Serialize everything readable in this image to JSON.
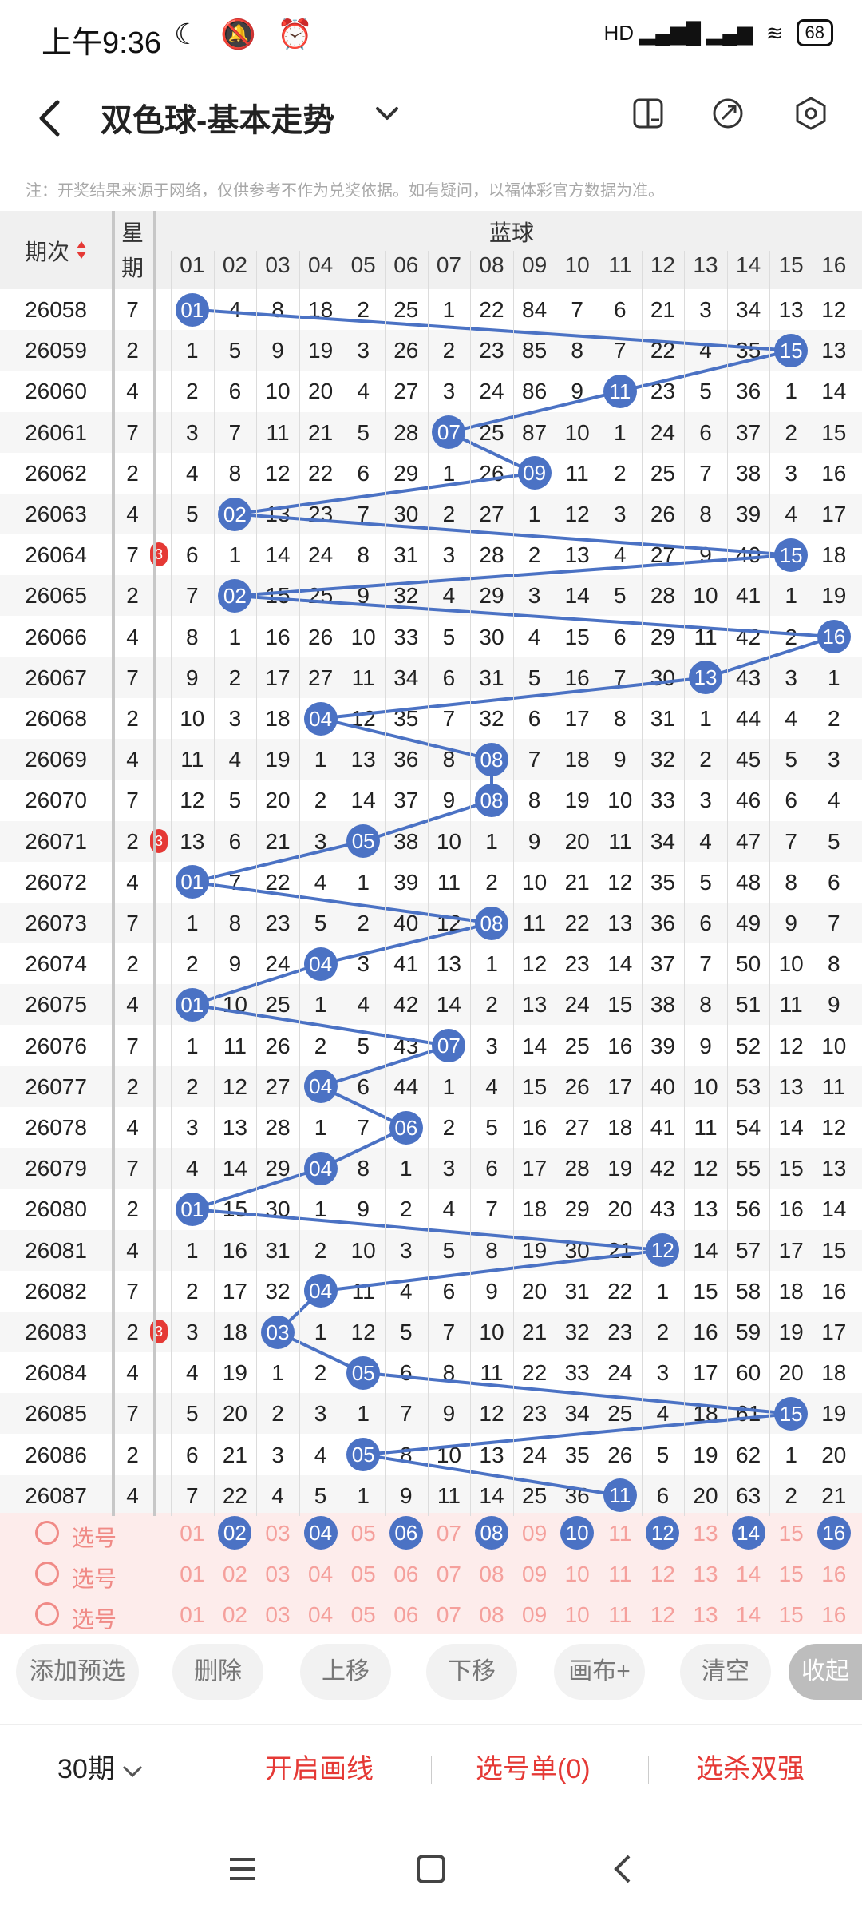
{
  "status": {
    "time": "上午9:36",
    "left_icons": "☾ 🔕 ⏰",
    "signal": "HD ▂▄▆█ ▂▄▆",
    "wifi": "≋",
    "battery": "68"
  },
  "header": {
    "title": "双色球-基本走势"
  },
  "note": "注：开奖结果来源于网络，仅供参考不作为兑奖依据。如有疑问，以福体彩官方数据为准。",
  "table": {
    "col_qici": "期次",
    "col_week_1": "星",
    "col_week_2": "期",
    "group_label": "蓝球",
    "col_numbers": [
      "01",
      "02",
      "03",
      "04",
      "05",
      "06",
      "07",
      "08",
      "09",
      "10",
      "11",
      "12",
      "13",
      "14",
      "15",
      "16"
    ],
    "rows": [
      {
        "q": "26058",
        "w": "7",
        "c": [
          "01",
          "4",
          "8",
          "18",
          "2",
          "25",
          "1",
          "22",
          "84",
          "7",
          "6",
          "21",
          "3",
          "34",
          "13",
          "12"
        ]
      },
      {
        "q": "26059",
        "w": "2",
        "c": [
          "1",
          "5",
          "9",
          "19",
          "3",
          "26",
          "2",
          "23",
          "85",
          "8",
          "7",
          "22",
          "4",
          "35",
          "15",
          "13"
        ]
      },
      {
        "q": "26060",
        "w": "4",
        "c": [
          "2",
          "6",
          "10",
          "20",
          "4",
          "27",
          "3",
          "24",
          "86",
          "9",
          "11",
          "23",
          "5",
          "36",
          "1",
          "14"
        ]
      },
      {
        "q": "26061",
        "w": "7",
        "c": [
          "3",
          "7",
          "11",
          "21",
          "5",
          "28",
          "07",
          "25",
          "87",
          "10",
          "1",
          "24",
          "6",
          "37",
          "2",
          "15"
        ]
      },
      {
        "q": "26062",
        "w": "2",
        "c": [
          "4",
          "8",
          "12",
          "22",
          "6",
          "29",
          "1",
          "26",
          "09",
          "11",
          "2",
          "25",
          "7",
          "38",
          "3",
          "16"
        ]
      },
      {
        "q": "26063",
        "w": "4",
        "c": [
          "5",
          "02",
          "13",
          "23",
          "7",
          "30",
          "2",
          "27",
          "1",
          "12",
          "3",
          "26",
          "8",
          "39",
          "4",
          "17"
        ]
      },
      {
        "q": "26064",
        "w": "7",
        "c": [
          "6",
          "1",
          "14",
          "24",
          "8",
          "31",
          "3",
          "28",
          "2",
          "13",
          "4",
          "27",
          "9",
          "40",
          "15",
          "18"
        ],
        "red": "3"
      },
      {
        "q": "26065",
        "w": "2",
        "c": [
          "7",
          "02",
          "15",
          "25",
          "9",
          "32",
          "4",
          "29",
          "3",
          "14",
          "5",
          "28",
          "10",
          "41",
          "1",
          "19"
        ]
      },
      {
        "q": "26066",
        "w": "4",
        "c": [
          "8",
          "1",
          "16",
          "26",
          "10",
          "33",
          "5",
          "30",
          "4",
          "15",
          "6",
          "29",
          "11",
          "42",
          "2",
          "16"
        ]
      },
      {
        "q": "26067",
        "w": "7",
        "c": [
          "9",
          "2",
          "17",
          "27",
          "11",
          "34",
          "6",
          "31",
          "5",
          "16",
          "7",
          "30",
          "13",
          "43",
          "3",
          "1"
        ]
      },
      {
        "q": "26068",
        "w": "2",
        "c": [
          "10",
          "3",
          "18",
          "04",
          "12",
          "35",
          "7",
          "32",
          "6",
          "17",
          "8",
          "31",
          "1",
          "44",
          "4",
          "2"
        ]
      },
      {
        "q": "26069",
        "w": "4",
        "c": [
          "11",
          "4",
          "19",
          "1",
          "13",
          "36",
          "8",
          "08",
          "7",
          "18",
          "9",
          "32",
          "2",
          "45",
          "5",
          "3"
        ]
      },
      {
        "q": "26070",
        "w": "7",
        "c": [
          "12",
          "5",
          "20",
          "2",
          "14",
          "37",
          "9",
          "08",
          "8",
          "19",
          "10",
          "33",
          "3",
          "46",
          "6",
          "4"
        ]
      },
      {
        "q": "26071",
        "w": "2",
        "c": [
          "13",
          "6",
          "21",
          "3",
          "05",
          "38",
          "10",
          "1",
          "9",
          "20",
          "11",
          "34",
          "4",
          "47",
          "7",
          "5"
        ],
        "red": "3"
      },
      {
        "q": "26072",
        "w": "4",
        "c": [
          "01",
          "7",
          "22",
          "4",
          "1",
          "39",
          "11",
          "2",
          "10",
          "21",
          "12",
          "35",
          "5",
          "48",
          "8",
          "6"
        ]
      },
      {
        "q": "26073",
        "w": "7",
        "c": [
          "1",
          "8",
          "23",
          "5",
          "2",
          "40",
          "12",
          "08",
          "11",
          "22",
          "13",
          "36",
          "6",
          "49",
          "9",
          "7"
        ]
      },
      {
        "q": "26074",
        "w": "2",
        "c": [
          "2",
          "9",
          "24",
          "04",
          "3",
          "41",
          "13",
          "1",
          "12",
          "23",
          "14",
          "37",
          "7",
          "50",
          "10",
          "8"
        ]
      },
      {
        "q": "26075",
        "w": "4",
        "c": [
          "01",
          "10",
          "25",
          "1",
          "4",
          "42",
          "14",
          "2",
          "13",
          "24",
          "15",
          "38",
          "8",
          "51",
          "11",
          "9"
        ]
      },
      {
        "q": "26076",
        "w": "7",
        "c": [
          "1",
          "11",
          "26",
          "2",
          "5",
          "43",
          "07",
          "3",
          "14",
          "25",
          "16",
          "39",
          "9",
          "52",
          "12",
          "10"
        ]
      },
      {
        "q": "26077",
        "w": "2",
        "c": [
          "2",
          "12",
          "27",
          "04",
          "6",
          "44",
          "1",
          "4",
          "15",
          "26",
          "17",
          "40",
          "10",
          "53",
          "13",
          "11"
        ]
      },
      {
        "q": "26078",
        "w": "4",
        "c": [
          "3",
          "13",
          "28",
          "1",
          "7",
          "06",
          "2",
          "5",
          "16",
          "27",
          "18",
          "41",
          "11",
          "54",
          "14",
          "12"
        ]
      },
      {
        "q": "26079",
        "w": "7",
        "c": [
          "4",
          "14",
          "29",
          "04",
          "8",
          "1",
          "3",
          "6",
          "17",
          "28",
          "19",
          "42",
          "12",
          "55",
          "15",
          "13"
        ]
      },
      {
        "q": "26080",
        "w": "2",
        "c": [
          "01",
          "15",
          "30",
          "1",
          "9",
          "2",
          "4",
          "7",
          "18",
          "29",
          "20",
          "43",
          "13",
          "56",
          "16",
          "14"
        ]
      },
      {
        "q": "26081",
        "w": "4",
        "c": [
          "1",
          "16",
          "31",
          "2",
          "10",
          "3",
          "5",
          "8",
          "19",
          "30",
          "21",
          "12",
          "14",
          "57",
          "17",
          "15"
        ]
      },
      {
        "q": "26082",
        "w": "7",
        "c": [
          "2",
          "17",
          "32",
          "04",
          "11",
          "4",
          "6",
          "9",
          "20",
          "31",
          "22",
          "1",
          "15",
          "58",
          "18",
          "16"
        ]
      },
      {
        "q": "26083",
        "w": "2",
        "c": [
          "3",
          "18",
          "03",
          "1",
          "12",
          "5",
          "7",
          "10",
          "21",
          "32",
          "23",
          "2",
          "16",
          "59",
          "19",
          "17"
        ],
        "red": "3"
      },
      {
        "q": "26084",
        "w": "4",
        "c": [
          "4",
          "19",
          "1",
          "2",
          "05",
          "6",
          "8",
          "11",
          "22",
          "33",
          "24",
          "3",
          "17",
          "60",
          "20",
          "18"
        ]
      },
      {
        "q": "26085",
        "w": "7",
        "c": [
          "5",
          "20",
          "2",
          "3",
          "1",
          "7",
          "9",
          "12",
          "23",
          "34",
          "25",
          "4",
          "18",
          "61",
          "15",
          "19"
        ]
      },
      {
        "q": "26086",
        "w": "2",
        "c": [
          "6",
          "21",
          "3",
          "4",
          "05",
          "8",
          "10",
          "13",
          "24",
          "35",
          "26",
          "5",
          "19",
          "62",
          "1",
          "20"
        ]
      },
      {
        "q": "26087",
        "w": "4",
        "c": [
          "7",
          "22",
          "4",
          "5",
          "1",
          "9",
          "11",
          "14",
          "25",
          "36",
          "11",
          "6",
          "20",
          "63",
          "2",
          "21"
        ]
      }
    ],
    "hits": [
      1,
      15,
      11,
      7,
      9,
      2,
      15,
      2,
      16,
      13,
      4,
      8,
      8,
      5,
      1,
      8,
      4,
      1,
      7,
      4,
      6,
      4,
      1,
      12,
      4,
      3,
      5,
      15,
      5,
      11
    ]
  },
  "pick": {
    "label": "选号",
    "numbers": [
      "01",
      "02",
      "03",
      "04",
      "05",
      "06",
      "07",
      "08",
      "09",
      "10",
      "11",
      "12",
      "13",
      "14",
      "15",
      "16"
    ],
    "row1_selected": [
      2,
      4,
      6,
      8,
      10,
      12,
      14,
      16
    ]
  },
  "actions": {
    "add": "添加预选",
    "delete": "删除",
    "up": "上移",
    "down": "下移",
    "canvas": "画布+",
    "clear": "清空",
    "collapse": "收起"
  },
  "bottom": {
    "periods": "30期",
    "draw": "开启画线",
    "picklist": "选号单(0)",
    "kill": "选杀双强"
  },
  "colors": {
    "ball": "#4b72c4",
    "accent_red": "#e53935",
    "pick_bg": "#fdeceb"
  }
}
